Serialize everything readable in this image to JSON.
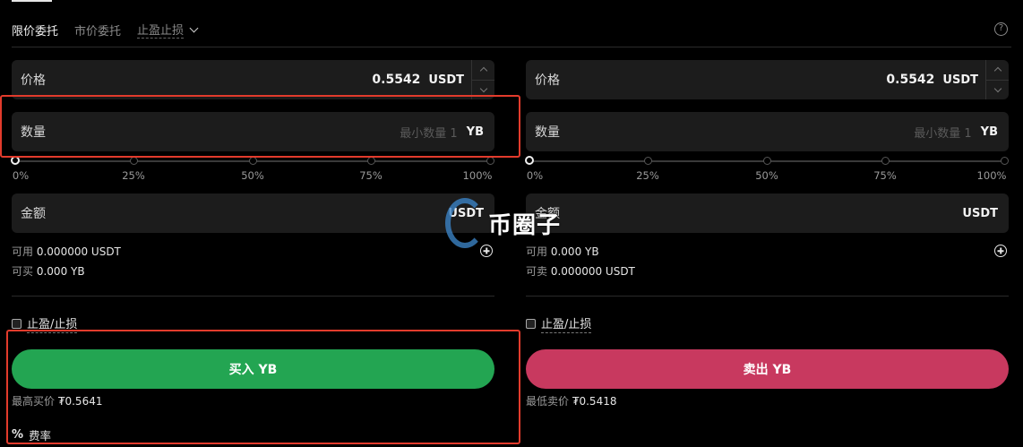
{
  "tabs": [
    {
      "label": "限价委托",
      "active": true
    },
    {
      "label": "市价委托",
      "active": false
    },
    {
      "label": "止盈止损",
      "active": false
    }
  ],
  "help_icon": "?",
  "slider_ticks": [
    "0%",
    "25%",
    "50%",
    "75%",
    "100%"
  ],
  "buy": {
    "price_label": "价格",
    "price_value": "0.5542",
    "price_unit": "USDT",
    "qty_label": "数量",
    "qty_placeholder": "最小数量 1",
    "qty_unit": "YB",
    "amount_label": "金额",
    "amount_unit": "USDT",
    "avail1_label": "可用",
    "avail1_value": "0.000000 USDT",
    "avail2_label": "可买",
    "avail2_value": "0.000 YB",
    "tpsl_label": "止盈/止损",
    "action_label": "买入 YB",
    "best_label": "最高买价",
    "best_value": "₮0.5641",
    "fee_icon": "%",
    "fee_label": "费率"
  },
  "sell": {
    "price_label": "价格",
    "price_value": "0.5542",
    "price_unit": "USDT",
    "qty_label": "数量",
    "qty_placeholder": "最小数量 1",
    "qty_unit": "YB",
    "amount_label": "金额",
    "amount_unit": "USDT",
    "avail1_label": "可用",
    "avail1_value": "0.000 YB",
    "avail2_label": "可卖",
    "avail2_value": "0.000000 USDT",
    "tpsl_label": "止盈/止损",
    "action_label": "卖出 YB",
    "best_label": "最低卖价",
    "best_value": "₮0.5418"
  },
  "watermark_text": "币圈子",
  "colors": {
    "buy": "#23a552",
    "sell": "#c8395f",
    "highlight": "#e23b2c",
    "field_bg": "#1c1c1c"
  }
}
